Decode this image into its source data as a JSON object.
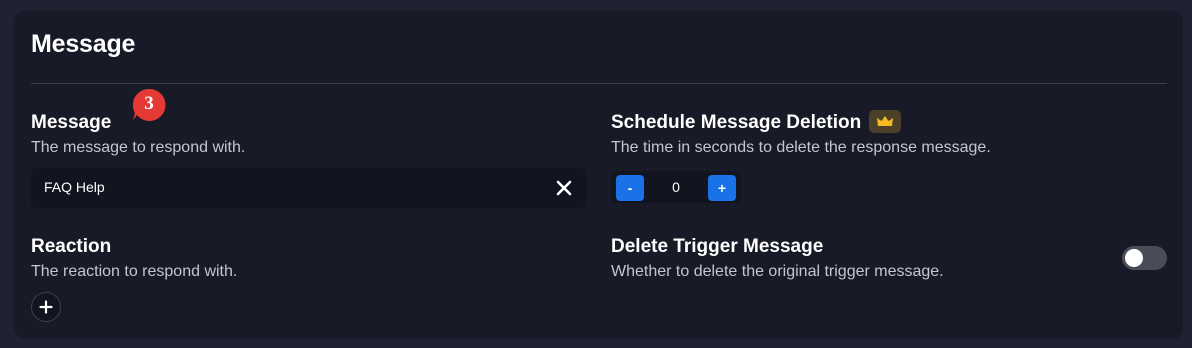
{
  "card": {
    "title": "Message"
  },
  "message": {
    "label": "Message",
    "description": "The message to respond with.",
    "input_value": "FAQ Help",
    "badge_count": "3"
  },
  "reaction": {
    "label": "Reaction",
    "description": "The reaction to respond with."
  },
  "schedule_deletion": {
    "label": "Schedule Message Deletion",
    "description": "The time in seconds to delete the response message.",
    "value": "0",
    "minus_label": "-",
    "plus_label": "+"
  },
  "delete_trigger": {
    "label": "Delete Trigger Message",
    "description": "Whether to delete the original trigger message.",
    "enabled": false
  },
  "colors": {
    "accent": "#1a72e8",
    "badge": "#e53935",
    "premium": "#f5b921",
    "card_bg": "#181b27",
    "page_bg": "#1f2231"
  },
  "icons": {
    "clear": "close-icon",
    "premium": "crown-icon",
    "add": "plus-icon"
  }
}
